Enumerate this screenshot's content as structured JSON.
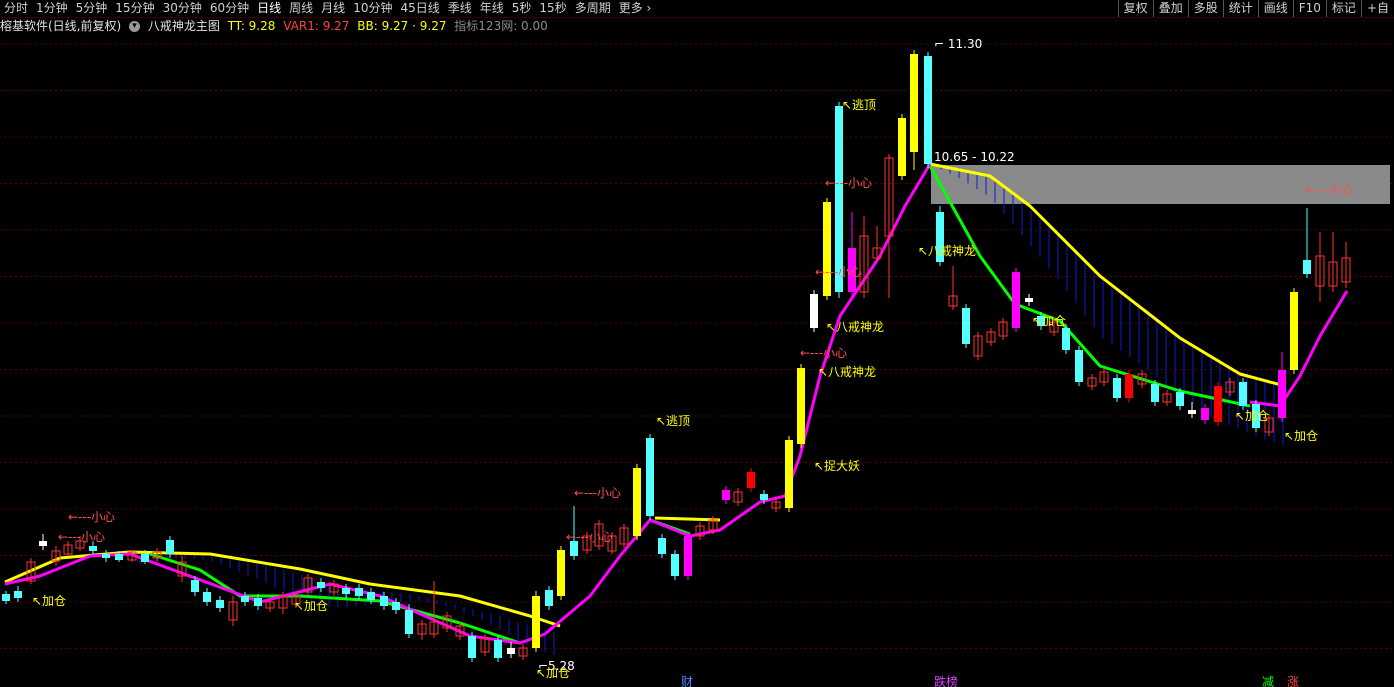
{
  "toolbar": {
    "periods": [
      {
        "label": "分时",
        "active": false
      },
      {
        "label": "1分钟",
        "active": false
      },
      {
        "label": "5分钟",
        "active": false
      },
      {
        "label": "15分钟",
        "active": false
      },
      {
        "label": "30分钟",
        "active": false
      },
      {
        "label": "60分钟",
        "active": false
      },
      {
        "label": "日线",
        "active": true
      },
      {
        "label": "周线",
        "active": false
      },
      {
        "label": "月线",
        "active": false
      },
      {
        "label": "10分钟",
        "active": false
      },
      {
        "label": "45日线",
        "active": false
      },
      {
        "label": "季线",
        "active": false
      },
      {
        "label": "年线",
        "active": false
      },
      {
        "label": "5秒",
        "active": false
      },
      {
        "label": "15秒",
        "active": false
      },
      {
        "label": "多周期",
        "active": false
      },
      {
        "label": "更多 ›",
        "active": false
      }
    ],
    "tools": [
      "复权",
      "叠加",
      "多股",
      "统计",
      "画线",
      "F10",
      "标记",
      "+自"
    ]
  },
  "info": {
    "app": "榕基软件(日线,前复权)",
    "indicator": "八戒神龙主图",
    "tt": "TT: 9.28",
    "var1": "VAR1: 9.27",
    "bb": "BB: 9.27 · 9.27",
    "idx": "指标123网: 0.00"
  },
  "colors": {
    "up": "#ff3333",
    "down": "#54ffff",
    "yellow": "#ffff00",
    "magenta": "#ff00ff",
    "green": "#00ff00",
    "signal": "#ffff00",
    "warn": "#ff5050",
    "grid": "#5a0000",
    "band": "#0a1dd6"
  },
  "chart_data": {
    "type": "candlestick",
    "price_labels": {
      "high": "11.30",
      "low": "5.28",
      "band": "10.65 - 10.22"
    },
    "signals": [
      "加仓",
      "加仓",
      "加仓",
      "加仓",
      "加仓",
      "加仓",
      "逃顶",
      "逃顶",
      "八戒神龙",
      "八戒神龙",
      "八戒神龙",
      "捉大妖",
      "小心",
      "小心",
      "小心",
      "小心",
      "小心",
      "小心",
      "小心",
      "小心"
    ],
    "bottom_marks": [
      "财",
      "跌榜",
      "减",
      "涨"
    ]
  }
}
